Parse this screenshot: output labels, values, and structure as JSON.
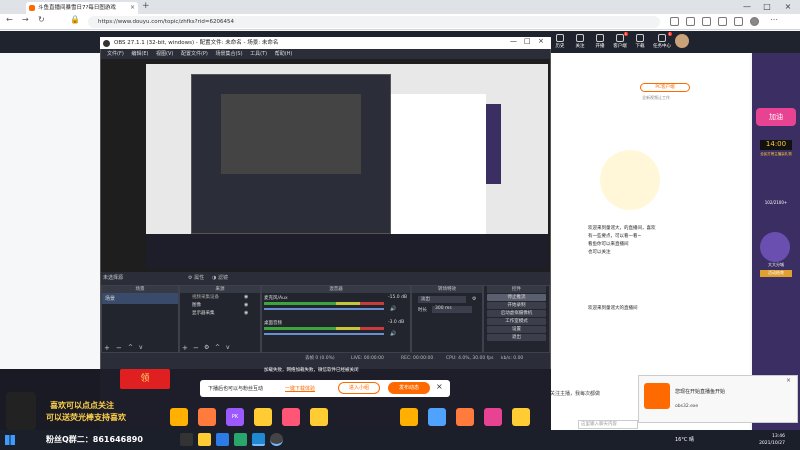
{
  "browser": {
    "tab_title": "斗鱼直播间暴雪日7?每日图游戏",
    "url": "https://www.douyu.com/topic/zhfks?rid=6206454",
    "tab_close": "×",
    "new_tab": "+"
  },
  "window_controls": {
    "minimize": "—",
    "maximize": "□",
    "close": "×"
  },
  "site_header": {
    "items": [
      {
        "label": "历史",
        "icon": "history-icon"
      },
      {
        "label": "关注",
        "icon": "follow-icon"
      },
      {
        "label": "开播",
        "icon": "live-icon"
      },
      {
        "label": "客户端",
        "icon": "client-icon",
        "badge": "1"
      },
      {
        "label": "下载",
        "icon": "download-icon"
      },
      {
        "label": "任务中心",
        "icon": "task-icon",
        "badge": "1"
      }
    ]
  },
  "obs": {
    "title": "OBS 27.1.1 (32-bit, windows) - 配置文件: 未命名 - 场景: 未命名",
    "menu": [
      "文件(F)",
      "编辑(E)",
      "视图(V)",
      "配置文件(P)",
      "场景集合(S)",
      "工具(T)",
      "帮助(H)"
    ],
    "no_source_label": "未选择源",
    "properties_btn": "属性",
    "filters_btn": "滤镜",
    "scenes_title": "场景",
    "scenes": [
      "场景"
    ],
    "sources_title": "来源",
    "sources": [
      "视频采集设备",
      "图像",
      "显示器采集"
    ],
    "mixer_title": "混音器",
    "mixer": [
      {
        "name": "麦克风/Aux",
        "db": "-15.0 dB"
      },
      {
        "name": "桌面音频",
        "db": "-3.0 dB"
      }
    ],
    "transitions_title": "转场特效",
    "transition_value": "淡出",
    "duration_label": "时长",
    "duration_value": "300 ms",
    "controls_title": "控件",
    "controls": [
      "停止推流",
      "开始录制",
      "启动虚拟摄像机",
      "工作室模式",
      "设置",
      "退出"
    ],
    "status": {
      "dropped": "丢帧 0 (0.0%)",
      "live": "LIVE: 00:00:00",
      "rec": "REC: 00:00:00",
      "cpu": "CPU: 4.0%, 30.00 fps",
      "kbps": "kb/s: 0.00"
    }
  },
  "stream_overlay": {
    "caption": "加载失败，网络加载失败，微信软件已经被关闭",
    "lottery": "领",
    "left_text_1": "喜欢可以点点关注",
    "left_text_2": "可以送荧光棒支持喜欢",
    "group_text": "粉丝Q群二：861646890",
    "gifts": [
      "荧光棒",
      "超级火箭",
      "弹幕",
      "PK"
    ]
  },
  "download_bar": {
    "text": "下播后也可以与粉丝互动",
    "link": "一键下载体验",
    "btn1": "进入小组",
    "btn2": "发布动态",
    "close": "×"
  },
  "right_page": {
    "pc_app": "PC客户端",
    "pc_sub": "全新视频让工作",
    "welcome": "欢迎来到童谣大，的直播间，喜欢",
    "lines": [
      "有一些要点，可以看一看~",
      "看鱼你可以来直播间",
      "也可以关注",
      "欢迎来到童谣大的直播间"
    ],
    "follow_prompt": "关注主播，我每次都做",
    "input_placeholder": "这里输入聊天内容"
  },
  "right_rail": {
    "event": "加油",
    "time": "14:00",
    "desc": "全民打榜主播赢礼物",
    "amount": "102/2100+",
    "label2": "大大分城",
    "label3": "活动结束"
  },
  "toast": {
    "title": "您现在开始直播鱼开始",
    "file": "obs32.exe"
  },
  "taskbar": {
    "weather": "16°C 晴",
    "time": "13:46",
    "date": "2021/10/27"
  },
  "colors": {
    "accent": "#ff6a00",
    "obs_bg": "#2b2e38",
    "taskbar": "#1b1f2a"
  }
}
